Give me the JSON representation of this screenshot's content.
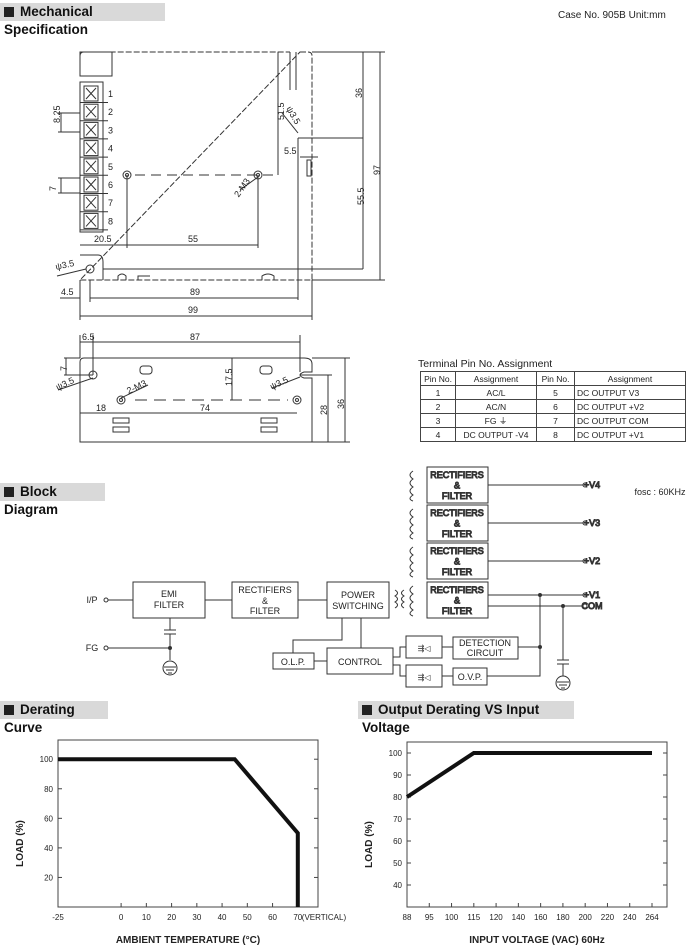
{
  "sections": {
    "mechanical": "Mechanical Specification",
    "block": "Block Diagram",
    "derating": "Derating Curve",
    "output_derating": "Output Derating VS Input Voltage"
  },
  "case_info": "Case No. 905B    Unit:mm",
  "mech": {
    "pins": [
      "1",
      "2",
      "3",
      "4",
      "5",
      "6",
      "7",
      "8"
    ],
    "d825": "8.25",
    "d7": "7",
    "d205": "20.5",
    "d55": "55",
    "d515": "51.5",
    "phi35": "ψ3.5",
    "d55b": "5.5",
    "m3": "2-M3",
    "d36": "36",
    "d555": "55.5",
    "d97": "97",
    "d45": "4.5",
    "d89": "89",
    "d99": "99",
    "s65": "6.5",
    "s87": "87",
    "s7": "7",
    "sphi": "ψ3.5",
    "sm3": "2-M3",
    "s175": "17.5",
    "sphi2": "ψ3.5",
    "s18": "18",
    "s74": "74",
    "s28": "28",
    "s36": "36"
  },
  "terminal": {
    "title": "Terminal Pin No.  Assignment",
    "headers": [
      "Pin No.",
      "Assignment",
      "Pin No.",
      "Assignment"
    ],
    "rows": [
      [
        "1",
        "AC/L",
        "5",
        "DC OUTPUT V3"
      ],
      [
        "2",
        "AC/N",
        "6",
        "DC OUTPUT +V2"
      ],
      [
        "3",
        "FG ⏚",
        "7",
        "DC OUTPUT COM"
      ],
      [
        "4",
        "DC OUTPUT -V4",
        "8",
        "DC OUTPUT +V1"
      ]
    ]
  },
  "block": {
    "fosc": "fosc : 60KHz",
    "ip": "I/P",
    "fg": "FG",
    "emi": [
      "EMI",
      "FILTER"
    ],
    "rect": [
      "RECTIFIERS",
      "&",
      "FILTER"
    ],
    "power": [
      "POWER",
      "SWITCHING"
    ],
    "olp": "O.L.P.",
    "control": "CONTROL",
    "detection": [
      "DETECTION",
      "CIRCUIT"
    ],
    "ovp": "O.V.P.",
    "outputs": [
      "+V4",
      "+V3",
      "+V2",
      "+V1",
      "COM"
    ]
  },
  "chart_data": [
    {
      "type": "line",
      "title": "Derating Curve",
      "xlabel": "AMBIENT TEMPERATURE (°C)",
      "ylabel": "LOAD (%)",
      "xticks": [
        "-25",
        "0",
        "10",
        "20",
        "30",
        "40",
        "50",
        "60",
        "70"
      ],
      "x_annotation": "(VERTICAL)",
      "yticks": [
        "20",
        "40",
        "60",
        "80",
        "100"
      ],
      "xlim": [
        -25,
        78
      ],
      "ylim": [
        0,
        113
      ],
      "points": [
        [
          -25,
          100
        ],
        [
          45,
          100
        ],
        [
          70,
          50
        ],
        [
          70,
          0
        ]
      ],
      "grid": false,
      "color": "#111111"
    },
    {
      "type": "line",
      "title": "Output Derating VS Input Voltage",
      "xlabel": "INPUT VOLTAGE (VAC) 60Hz",
      "ylabel": "LOAD (%)",
      "xticks": [
        "88",
        "95",
        "100",
        "115",
        "120",
        "140",
        "160",
        "180",
        "200",
        "220",
        "240",
        "264"
      ],
      "yticks": [
        "40",
        "50",
        "60",
        "70",
        "80",
        "90",
        "100"
      ],
      "ylim": [
        30,
        105
      ],
      "points": [
        [
          88,
          80
        ],
        [
          115,
          100
        ],
        [
          264,
          100
        ]
      ],
      "grid": false,
      "color": "#111111"
    }
  ]
}
